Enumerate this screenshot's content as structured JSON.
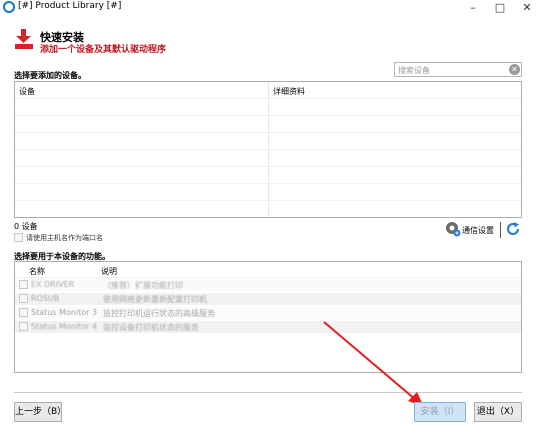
{
  "window": {
    "title": "[#] Product Library [#]",
    "controls": [
      "–",
      "□",
      "✕"
    ]
  },
  "header": {
    "title": "快速安装",
    "subtitle": "添加一个设备及其默认驱动程序",
    "accent_color": "#c0191f"
  },
  "devices": {
    "label": "选择要添加的设备。",
    "search_placeholder": "搜索设备",
    "columns": [
      "设备",
      "详细资料"
    ],
    "count_text": "0 设备",
    "hostname_checkbox_label": "请使用主机名作为端口名",
    "comm_settings": "通信设置"
  },
  "features": {
    "label": "选择要用于本设备的功能。",
    "columns": [
      "名称",
      "说明"
    ],
    "items": [
      {
        "name": "EX DRIVER",
        "desc": "（推荐）扩展功能打印"
      },
      {
        "name": "ROSUB",
        "desc": "使用网络更新重新配置打印机"
      },
      {
        "name": "Status Monitor 3",
        "desc": "监控打印机运行状态的高级服务"
      },
      {
        "name": "Status Monitor 4",
        "desc": "监控设备打印机状态的服务"
      }
    ]
  },
  "buttons": {
    "back": "上一步（B）",
    "install": "安装（I）",
    "exit": "退出（X）"
  }
}
